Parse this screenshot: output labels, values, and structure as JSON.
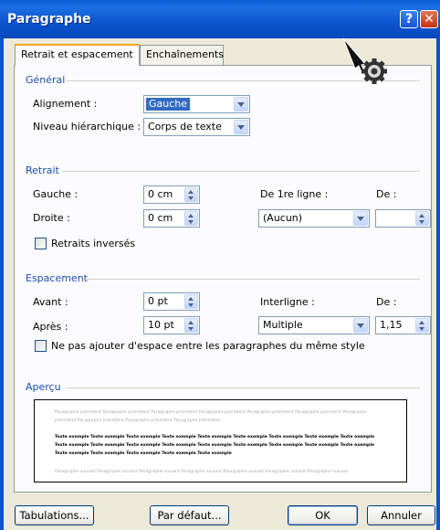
{
  "window": {
    "title": "Paragraphe"
  },
  "tabs": [
    {
      "label": "Retrait et espacement",
      "active": true
    },
    {
      "label": "Enchaînements",
      "active": false
    }
  ],
  "general": {
    "section_title": "Général",
    "alignment": {
      "label": "Alignement :",
      "value": "Gauche"
    },
    "outline_level": {
      "label": "Niveau hiérarchique :",
      "value": "Corps de texte"
    }
  },
  "indent": {
    "section_title": "Retrait",
    "left": {
      "label": "Gauche :",
      "value": "0 cm"
    },
    "right": {
      "label": "Droite :",
      "value": "0 cm"
    },
    "first_line": {
      "label": "De 1re ligne :",
      "value": "(Aucun)"
    },
    "by": {
      "label": "De :",
      "value": ""
    },
    "mirror": {
      "label": "Retraits inversés",
      "checked": false
    }
  },
  "spacing": {
    "section_title": "Espacement",
    "before": {
      "label": "Avant :",
      "value": "0 pt"
    },
    "after": {
      "label": "Après :",
      "value": "10 pt"
    },
    "line_spacing": {
      "label": "Interligne :",
      "value": "Multiple"
    },
    "at": {
      "label": "De :",
      "value": "1,15"
    },
    "no_space_same_style": {
      "label": "Ne pas ajouter d'espace entre les paragraphes du même style",
      "checked": false
    }
  },
  "preview": {
    "section_title": "Aperçu",
    "previous_text": "Paragraphe précédent Paragraphe précédent Paragraphe précédent Paragraphe précédent Paragraphe précédent Paragraphe précédent Paragraphe précédent Paragraphe précédent Paragraphe précédent Paragraphe précédent",
    "sample_text": "Texte exemple Texte exemple Texte exemple Texte exemple Texte exemple Texte exemple Texte exemple Texte exemple Texte exemple Texte exemple Texte exemple Texte exemple Texte exemple Texte exemple Texte exemple Texte exemple Texte exemple Texte exemple Texte exemple Texte exemple Texte exemple Texte exemple Texte exemple",
    "next_text": "Paragraphe suivant Paragraphe suivant Paragraphe suivant Paragraphe suivant Paragraphe suivant Paragraphe suivant Paragraphe suivant"
  },
  "buttons": {
    "tabs": "Tabulations...",
    "default": "Par défaut...",
    "ok": "OK",
    "cancel": "Annuler"
  },
  "icons": {
    "help": "help-icon",
    "close": "close-icon",
    "cursor": "gear-cursor-icon"
  }
}
